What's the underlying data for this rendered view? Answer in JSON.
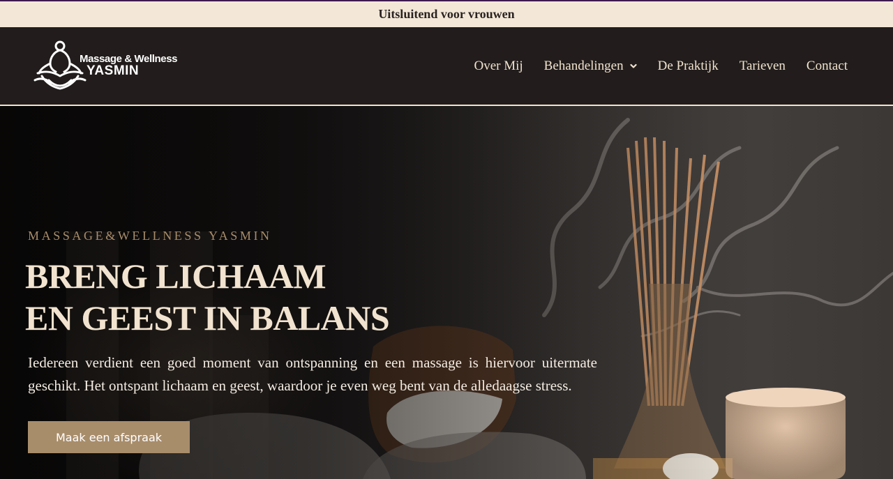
{
  "announcement": {
    "text": "Uitsluitend voor vrouwen"
  },
  "header": {
    "logo": {
      "line1": "Massage & Wellness",
      "line2": "YASMIN"
    },
    "nav": [
      {
        "label": "Over Mij"
      },
      {
        "label": "Behandelingen",
        "has_dropdown": true
      },
      {
        "label": "De Praktijk"
      },
      {
        "label": "Tarieven"
      },
      {
        "label": "Contact"
      }
    ]
  },
  "hero": {
    "kicker": "MASSAGE&WELLNESS YASMIN",
    "title_line1": "BRENG LICHAAM",
    "title_line2": "EN GEEST IN BALANS",
    "lead": "Iedereen verdient een goed moment van ontspanning en een massage is hiervoor uitermate geschikt. Het ontspant lichaam en geest, waardoor je even weg bent van de alledaagse stress.",
    "cta_label": "Maak een afspraak"
  },
  "colors": {
    "announcement_bg": "#f3e8d8",
    "header_bg": "#221d1c",
    "nav_text": "#f1e3cf",
    "accent": "#a88d6b",
    "hero_title": "#f1e3cf"
  },
  "icons": {
    "logo_mark": "meditating-figure-lotus-icon",
    "dropdown": "chevron-down-icon"
  }
}
